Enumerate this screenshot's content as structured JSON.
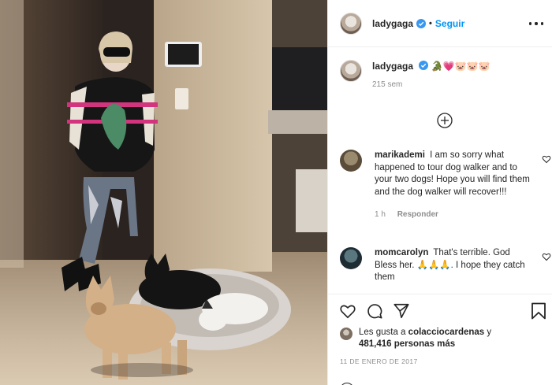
{
  "post": {
    "username": "ladygaga",
    "follow_label": "Seguir",
    "separator": "•"
  },
  "caption": {
    "username": "ladygaga",
    "text": "🐊💗🐷🐷🐷",
    "time": "215 sem"
  },
  "comments": [
    {
      "username": "marikademi",
      "text": "I am so sorry what happened to tour dog walker and to your two dogs! Hope you will find them and the dog walker will recover!!!",
      "time": "1 h",
      "reply_label": "Responder"
    },
    {
      "username": "momcarolyn",
      "text": "That's terrible. God Bless her. 🙏🙏🙏. I hope they catch them",
      "time": "",
      "reply_label": ""
    }
  ],
  "likes": {
    "prefix": "Les gusta a",
    "user": "colacciocardenas",
    "middle": "y",
    "count_text": "481,416 personas más"
  },
  "date": "11 DE ENERO DE 2017",
  "icons": [
    "verified-icon",
    "more-options-icon",
    "add-comment-icon",
    "heart-icon",
    "comment-icon",
    "share-icon",
    "bookmark-icon"
  ],
  "colors": {
    "link": "#0095f6",
    "verified": "#3897f0",
    "muted": "#8e8e8e"
  }
}
